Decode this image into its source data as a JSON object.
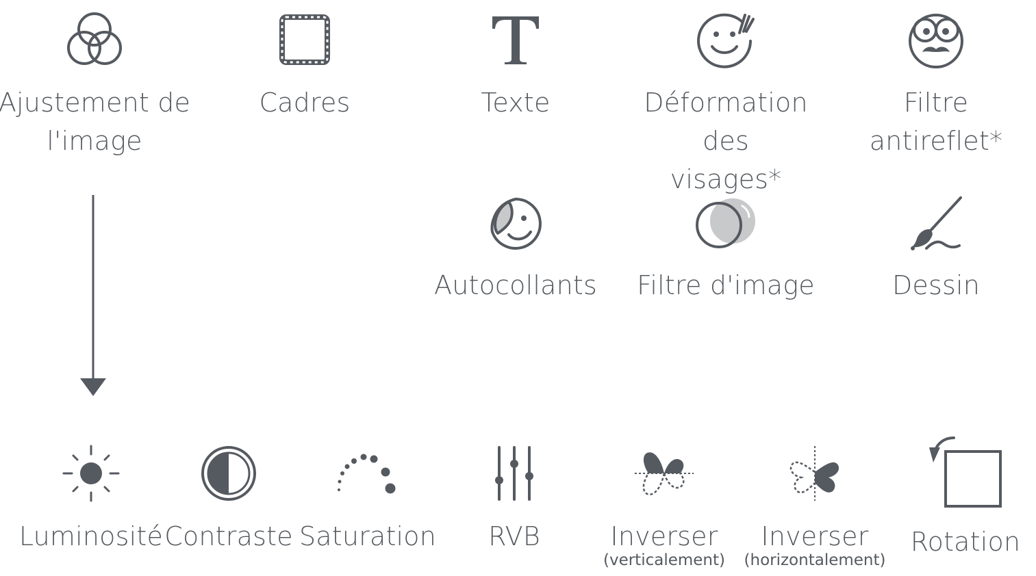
{
  "colors": {
    "icon": "#555a60",
    "icon_fill": "#555a60",
    "light_fill": "#c8c9cb",
    "background": "#ffffff"
  },
  "top_row": [
    {
      "id": "image-adjust",
      "label": "Ajustement de\nl'image",
      "icon": "three-circles-icon"
    },
    {
      "id": "frames",
      "label": "Cadres",
      "icon": "frame-icon"
    },
    {
      "id": "text",
      "label": "Texte",
      "icon": "text-t-icon"
    },
    {
      "id": "face-warp",
      "label": "Déformation des\nvisages*",
      "icon": "smiley-face-icon"
    },
    {
      "id": "anti-glare",
      "label": "Filtre antireflet*",
      "icon": "glasses-mustache-face-icon"
    }
  ],
  "middle_row": [
    {
      "id": "stickers",
      "label": "Autocollants",
      "icon": "sticker-icon"
    },
    {
      "id": "image-filter",
      "label": "Filtre d'image",
      "icon": "filter-circles-icon"
    },
    {
      "id": "drawing",
      "label": "Dessin",
      "icon": "paintbrush-icon"
    }
  ],
  "bottom_row": [
    {
      "id": "brightness",
      "label": "Luminosité",
      "icon": "sun-icon"
    },
    {
      "id": "contrast",
      "label": "Contraste",
      "icon": "contrast-icon"
    },
    {
      "id": "saturation",
      "label": "Saturation",
      "icon": "saturation-dots-icon"
    },
    {
      "id": "rgb",
      "label": "RVB",
      "icon": "sliders-icon"
    },
    {
      "id": "flip-vertical",
      "label": "Inverser",
      "sublabel": "(verticalement)",
      "icon": "butterfly-flip-vertical-icon"
    },
    {
      "id": "flip-horizontal",
      "label": "Inverser",
      "sublabel": "(horizontalement)",
      "icon": "butterfly-flip-horizontal-icon"
    },
    {
      "id": "rotation",
      "label": "Rotation",
      "icon": "rotate-square-icon"
    }
  ]
}
